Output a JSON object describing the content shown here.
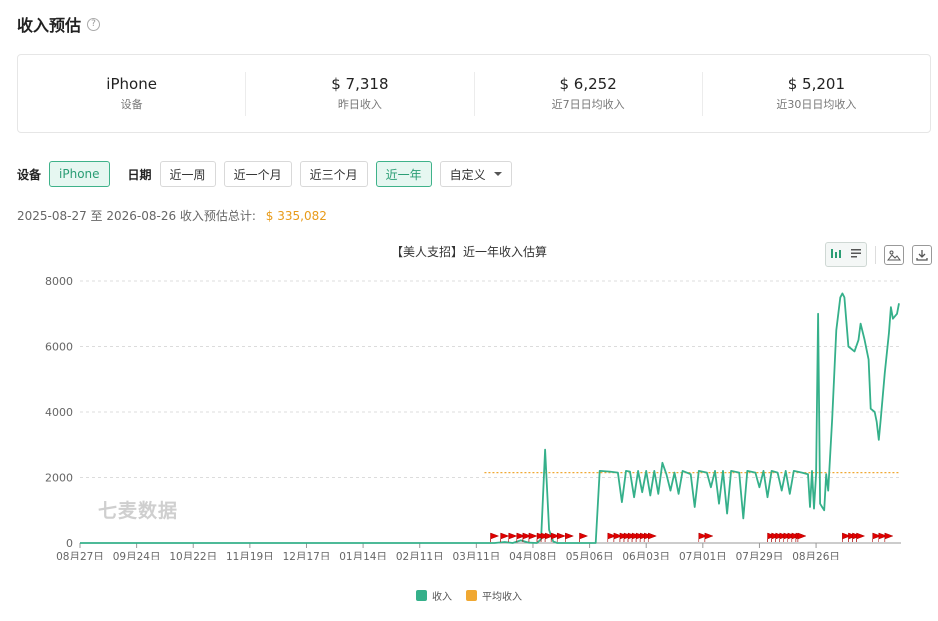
{
  "header": {
    "title": "收入预估",
    "help_icon": "question-circle-icon"
  },
  "stats": [
    {
      "value": "iPhone",
      "label": "设备"
    },
    {
      "value": "$ 7,318",
      "label": "昨日收入"
    },
    {
      "value": "$ 6,252",
      "label": "近7日日均收入"
    },
    {
      "value": "$ 5,201",
      "label": "近30日日均收入"
    }
  ],
  "filters": {
    "device_label": "设备",
    "device_selected": "iPhone",
    "date_label": "日期",
    "date_options": [
      "近一周",
      "近一个月",
      "近三个月",
      "近一年"
    ],
    "date_selected": "近一年",
    "custom_label": "自定义"
  },
  "summary": {
    "text": "2025-08-27 至 2026-08-26 收入预估总计:",
    "total": "$ 335,082"
  },
  "colors": {
    "accent": "#2a9d74",
    "series_income": "#35b08a",
    "series_avg": "#f0a832",
    "total_text": "#e89b1a",
    "marker": "#e00000"
  },
  "watermark": "七麦数据",
  "chart_data": {
    "type": "line",
    "title": "【美人支招】近一年收入估算",
    "xlabel": "",
    "ylabel": "",
    "ylim": [
      0,
      8000
    ],
    "yticks": [
      0,
      2000,
      4000,
      6000,
      8000
    ],
    "x_ticks": [
      "08月27日",
      "09月24日",
      "10月22日",
      "11月19日",
      "12月17日",
      "01月14日",
      "02月11日",
      "03月11日",
      "04月08日",
      "05月06日",
      "06月03日",
      "07月01日",
      "07月29日",
      "08月26日"
    ],
    "legend": [
      "收入",
      "平均收入"
    ],
    "legend_position": "bottom-center",
    "grid": true,
    "series": [
      {
        "name": "收入",
        "points": [
          [
            0,
            0
          ],
          [
            205,
            0
          ],
          [
            210,
            30
          ],
          [
            214,
            0
          ],
          [
            218,
            80
          ],
          [
            222,
            10
          ],
          [
            226,
            0
          ],
          [
            228,
            120
          ],
          [
            230,
            2850
          ],
          [
            232,
            400
          ],
          [
            234,
            50
          ],
          [
            236,
            0
          ],
          [
            250,
            0
          ],
          [
            255,
            0
          ],
          [
            257,
            2200
          ],
          [
            262,
            2180
          ],
          [
            266,
            2150
          ],
          [
            268,
            1250
          ],
          [
            270,
            2200
          ],
          [
            272,
            2180
          ],
          [
            274,
            1400
          ],
          [
            276,
            2200
          ],
          [
            278,
            1550
          ],
          [
            280,
            2200
          ],
          [
            282,
            1450
          ],
          [
            284,
            2200
          ],
          [
            286,
            1500
          ],
          [
            288,
            2450
          ],
          [
            290,
            2100
          ],
          [
            292,
            1600
          ],
          [
            294,
            2150
          ],
          [
            296,
            1500
          ],
          [
            298,
            2200
          ],
          [
            302,
            2100
          ],
          [
            304,
            1100
          ],
          [
            306,
            2200
          ],
          [
            310,
            2150
          ],
          [
            312,
            1700
          ],
          [
            314,
            2200
          ],
          [
            316,
            1200
          ],
          [
            318,
            2200
          ],
          [
            320,
            900
          ],
          [
            322,
            2200
          ],
          [
            326,
            2150
          ],
          [
            328,
            750
          ],
          [
            330,
            2200
          ],
          [
            334,
            2150
          ],
          [
            336,
            1700
          ],
          [
            338,
            2200
          ],
          [
            340,
            1400
          ],
          [
            342,
            2200
          ],
          [
            345,
            2150
          ],
          [
            347,
            1600
          ],
          [
            349,
            2200
          ],
          [
            351,
            1500
          ],
          [
            353,
            2200
          ],
          [
            357,
            2150
          ],
          [
            360,
            2100
          ],
          [
            361,
            1100
          ],
          [
            362,
            2200
          ],
          [
            363,
            1050
          ],
          [
            364,
            2100
          ],
          [
            365,
            7000
          ],
          [
            366,
            1200
          ],
          [
            367,
            1100
          ],
          [
            368,
            1000
          ],
          [
            369,
            2100
          ],
          [
            370,
            1600
          ],
          [
            372,
            3800
          ],
          [
            374,
            6500
          ],
          [
            376,
            7500
          ],
          [
            377,
            7620
          ],
          [
            378,
            7500
          ],
          [
            380,
            6000
          ],
          [
            383,
            5850
          ],
          [
            385,
            6200
          ],
          [
            386,
            6700
          ],
          [
            388,
            6200
          ],
          [
            390,
            5600
          ],
          [
            391,
            4100
          ],
          [
            393,
            4000
          ],
          [
            394,
            3700
          ],
          [
            395,
            3150
          ],
          [
            396,
            3800
          ],
          [
            398,
            5200
          ],
          [
            400,
            6400
          ],
          [
            401,
            7200
          ],
          [
            402,
            6850
          ],
          [
            404,
            7000
          ],
          [
            405,
            7318
          ]
        ]
      },
      {
        "name": "平均收入",
        "value": 2150,
        "x_range": [
          200,
          405
        ]
      }
    ],
    "markers_x": [
      203,
      208,
      212,
      216,
      219,
      222,
      226,
      228,
      230,
      233,
      236,
      240,
      247,
      261,
      264,
      267,
      269,
      271,
      273,
      275,
      277,
      279,
      281,
      306,
      309,
      340,
      342,
      344,
      346,
      348,
      350,
      352,
      354,
      355,
      377,
      380,
      382,
      384,
      392,
      395,
      398
    ]
  }
}
